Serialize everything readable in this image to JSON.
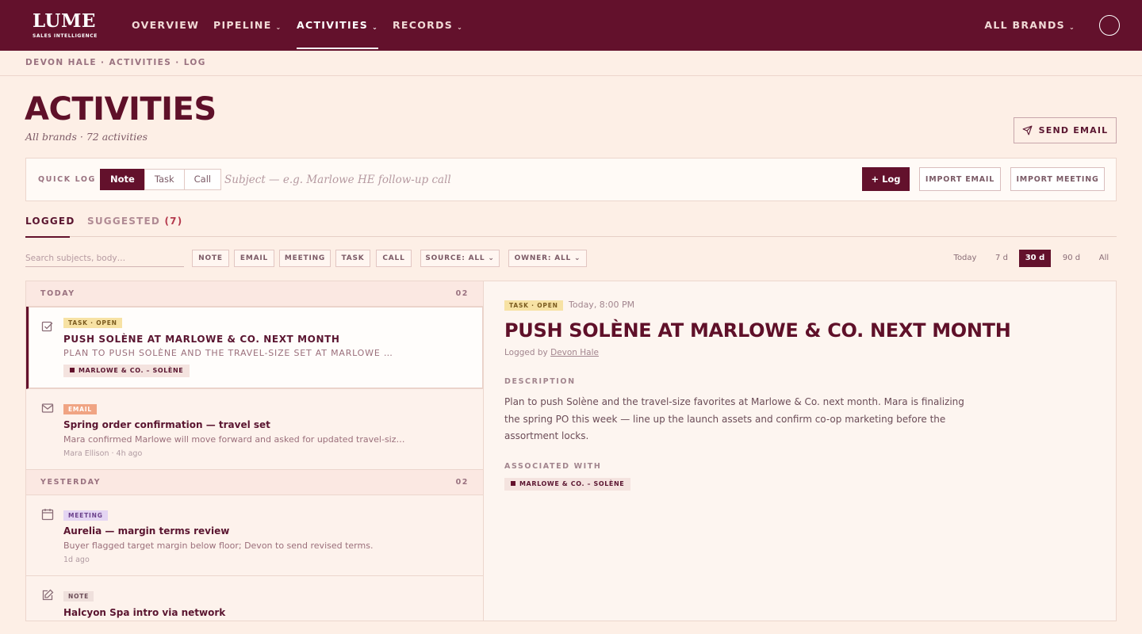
{
  "brand": {
    "name": "LUME",
    "tagline": "SALES INTELLIGENCE"
  },
  "nav": {
    "items": [
      {
        "label": "OVERVIEW",
        "caret": ""
      },
      {
        "label": "PIPELINE",
        "caret": "⌄"
      },
      {
        "label": "ACTIVITIES",
        "caret": "⌄"
      },
      {
        "label": "RECORDS",
        "caret": "⌄"
      }
    ],
    "brand_selector": "ALL BRANDS",
    "brand_selector_caret": "⌄"
  },
  "breadcrumb": "DEVON HALE · ACTIVITIES · LOG",
  "header": {
    "title": "ACTIVITIES",
    "subtitle": "All brands · 72 activities",
    "send_email": "SEND EMAIL"
  },
  "quick_log": {
    "label": "QUICK LOG",
    "types": [
      "Note",
      "Task",
      "Call"
    ],
    "selected_type": "Note",
    "placeholder": "Subject — e.g. Marlowe HE follow-up call",
    "log_button": "+ Log",
    "import_email": "IMPORT EMAIL",
    "import_meeting": "IMPORT MEETING"
  },
  "tabs": [
    {
      "label": "LOGGED",
      "count": ""
    },
    {
      "label": "SUGGESTED",
      "count": "(7)"
    }
  ],
  "filters": {
    "search_placeholder": "Search subjects, body…",
    "types": [
      "NOTE",
      "EMAIL",
      "MEETING",
      "TASK",
      "CALL"
    ],
    "source": "SOURCE: ALL ⌄",
    "owner": "OWNER: ALL ⌄",
    "ranges": [
      "Today",
      "7 d",
      "30 d",
      "90 d",
      "All"
    ],
    "selected_range": "30 d"
  },
  "list": {
    "groups": [
      {
        "label": "TODAY",
        "count": "02"
      },
      {
        "label": "YESTERDAY",
        "count": "02"
      }
    ],
    "items": [
      {
        "type": "TASK · OPEN",
        "title": "PUSH SOLÈNE AT MARLOWE & CO. NEXT MONTH",
        "body": "PLAN TO PUSH SOLÈNE AND THE TRAVEL-SIZE SET AT MARLOWE …",
        "association": "MARLOWE & CO. – SOLÈNE"
      },
      {
        "type": "EMAIL",
        "title": "Spring order confirmation — travel set",
        "body": "Mara confirmed Marlowe will move forward and asked for updated travel-siz…",
        "meta": "Mara Ellison · 4h ago"
      },
      {
        "type": "MEETING",
        "title": "Aurelia — margin terms review",
        "body": "Buyer flagged target margin below floor; Devon to send revised terms.",
        "meta": "1d ago"
      },
      {
        "type": "NOTE",
        "title": "Halcyon Spa intro via network"
      }
    ]
  },
  "detail": {
    "badge": "TASK · OPEN",
    "time": "Today, 8:00 PM",
    "title": "PUSH SOLÈNE AT MARLOWE & CO. NEXT MONTH",
    "logged_by_prefix": "Logged by",
    "logged_by": "Devon Hale",
    "description_label": "DESCRIPTION",
    "description": "Plan to push Solène and the travel-size favorites at Marlowe & Co. next month. Mara is finalizing the spring PO this week — line up the launch assets and confirm co-op marketing before the assortment locks.",
    "associated_label": "ASSOCIATED WITH",
    "association": "MARLOWE & CO. – SOLÈNE"
  },
  "colors": {
    "primary": "#63112c",
    "background": "#fdefe6",
    "task": "#f7e2a4",
    "email": "#f0a483",
    "meeting": "#e4d5f3"
  }
}
